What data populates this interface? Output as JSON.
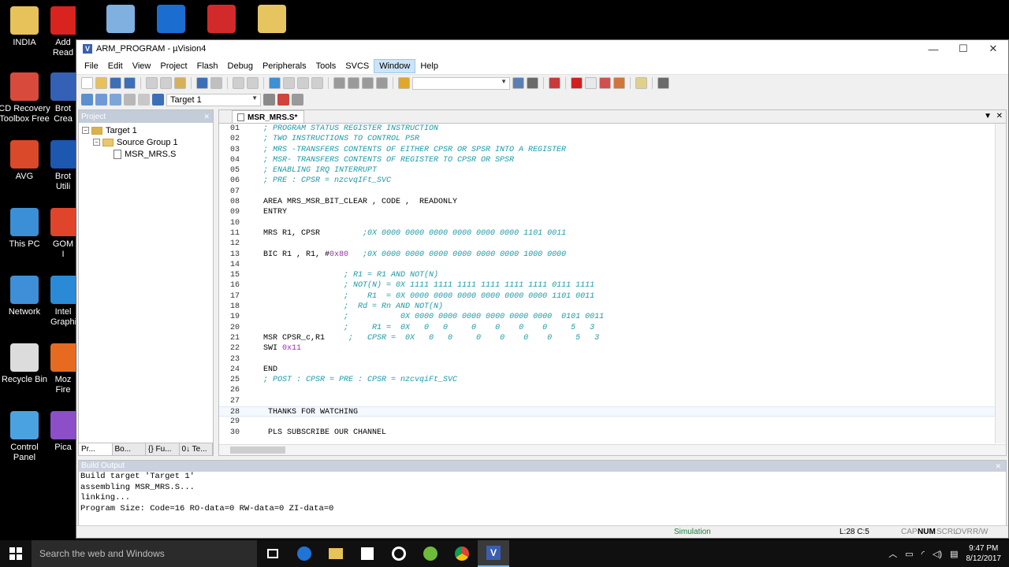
{
  "desktop": {
    "icons_col1": [
      {
        "label": "INDIA",
        "color": "#e7c25a"
      },
      {
        "label": "CD Recovery Toolbox Free",
        "color": "#d84b3c"
      },
      {
        "label": "AVG",
        "color": "#d9492a"
      },
      {
        "label": "This PC",
        "color": "#3b8fd6"
      },
      {
        "label": "Network",
        "color": "#3e8fd8"
      },
      {
        "label": "Recycle Bin",
        "color": "#dcdcdc"
      },
      {
        "label": "Control Panel",
        "color": "#4aa3e0"
      }
    ],
    "icons_col2": [
      {
        "label": "Add Read",
        "color": "#d9231f"
      },
      {
        "label": "Brot Crea",
        "color": "#3460b5"
      },
      {
        "label": "Brot Utili",
        "color": "#1c57b0"
      },
      {
        "label": "GOM I",
        "color": "#e0442a"
      },
      {
        "label": "Intel Graphi",
        "color": "#2a8ad6"
      },
      {
        "label": "Moz Fire",
        "color": "#e66a1f"
      },
      {
        "label": "Pica",
        "color": "#8c4fc8"
      }
    ],
    "icons_top": [
      {
        "label": "",
        "color": "#e8c15b"
      },
      {
        "label": "",
        "color": "#d12b2b"
      },
      {
        "label": "",
        "color": "#7fb0e0"
      },
      {
        "label": "",
        "color": "#1c6dd0"
      },
      {
        "label": "",
        "color": "#d22a2a"
      },
      {
        "label": "",
        "color": "#e6c460"
      }
    ]
  },
  "window": {
    "title": "ARM_PROGRAM - µVision4",
    "controls": {
      "minimize": "—",
      "maximize": "☐",
      "close": "✕"
    }
  },
  "menu": [
    "File",
    "Edit",
    "View",
    "Project",
    "Flash",
    "Debug",
    "Peripherals",
    "Tools",
    "SVCS",
    "Window",
    "Help"
  ],
  "menu_active": "Window",
  "toolbar2": {
    "target": "Target 1"
  },
  "project": {
    "header": "Project",
    "tree": {
      "target": "Target 1",
      "group": "Source Group 1",
      "file": "MSR_MRS.S"
    },
    "tabs": [
      "Pr...",
      "Bo...",
      "{} Fu...",
      "0↓ Te..."
    ]
  },
  "editor": {
    "tab_label": "MSR_MRS.S*",
    "current_line": 28,
    "lines": [
      {
        "n": "01",
        "code": "",
        "comment": "; PROGRAM STATUS REGISTER INSTRUCTION"
      },
      {
        "n": "02",
        "code": "",
        "comment": "; TWO INSTRUCTIONS TO CONTROL PSR"
      },
      {
        "n": "03",
        "code": "",
        "comment": "; MRS -TRANSFERS CONTENTS OF EITHER CPSR OR SPSR INTO A REGISTER"
      },
      {
        "n": "04",
        "code": "",
        "comment": "; MSR- TRANSFERS CONTENTS OF REGISTER TO CPSR OR SPSR"
      },
      {
        "n": "05",
        "code": "",
        "comment": "; ENABLING IRQ INTERRUPT"
      },
      {
        "n": "06",
        "code": "",
        "comment": "; PRE : CPSR = nzcvqIFt_SVC"
      },
      {
        "n": "07",
        "code": "",
        "comment": ""
      },
      {
        "n": "08",
        "code": "AREA MRS_MSR_BIT_CLEAR , CODE ,  READONLY",
        "comment": ""
      },
      {
        "n": "09",
        "code": "ENTRY",
        "comment": ""
      },
      {
        "n": "10",
        "code": "",
        "comment": ""
      },
      {
        "n": "11",
        "code": "MRS R1, CPSR         ",
        "comment": ";0X 0000 0000 0000 0000 0000 0000 1101 0011"
      },
      {
        "n": "12",
        "code": "",
        "comment": ""
      },
      {
        "n": "13",
        "code": "BIC R1 , R1, #",
        "num": "0x80",
        "code2": "   ",
        "comment": ";0X 0000 0000 0000 0000 0000 0000 1000 0000"
      },
      {
        "n": "14",
        "code": "",
        "comment": ""
      },
      {
        "n": "15",
        "code": "                 ",
        "comment": "; R1 = R1 AND NOT(N)"
      },
      {
        "n": "16",
        "code": "                 ",
        "comment": "; NOT(N) = 0X 1111 1111 1111 1111 1111 1111 0111 1111"
      },
      {
        "n": "17",
        "code": "                 ",
        "comment": ";    R1  = 0X 0000 0000 0000 0000 0000 0000 1101 0011"
      },
      {
        "n": "18",
        "code": "                 ",
        "comment": ";  Rd = Rn AND NOT(N)"
      },
      {
        "n": "19",
        "code": "                 ",
        "comment": ";           0X 0000 0000 0000 0000 0000 0000  0101 0011"
      },
      {
        "n": "20",
        "code": "                 ",
        "comment": ";     R1 =  0X   0   0     0    0    0    0     5   3"
      },
      {
        "n": "21",
        "code": "MSR CPSR_c,R1     ",
        "comment": ";   CPSR =  0X   0   0     0    0    0    0     5   3"
      },
      {
        "n": "22",
        "code": "SWI ",
        "num": "0x11",
        "code2": "",
        "comment": ""
      },
      {
        "n": "23",
        "code": "",
        "comment": ""
      },
      {
        "n": "24",
        "code": "END",
        "comment": ""
      },
      {
        "n": "25",
        "code": "",
        "comment": "; POST : CPSR = PRE : CPSR = nzcvqiFt_SVC"
      },
      {
        "n": "26",
        "code": "",
        "comment": ""
      },
      {
        "n": "27",
        "code": "",
        "comment": ""
      },
      {
        "n": "28",
        "code": " THANKS FOR WATCHING",
        "comment": ""
      },
      {
        "n": "29",
        "code": "",
        "comment": ""
      },
      {
        "n": "30",
        "code": " PLS SUBSCRIBE OUR CHANNEL",
        "comment": ""
      }
    ]
  },
  "build": {
    "header": "Build Output",
    "lines": [
      "Build target 'Target 1'",
      "assembling MSR_MRS.S...",
      "linking...",
      "Program Size: Code=16 RO-data=0 RW-data=0 ZI-data=0"
    ]
  },
  "status": {
    "mode": "Simulation",
    "position": "L:28 C:5",
    "caps": "CAP",
    "num": "NUM",
    "scrl": "SCRL",
    "ovr": "OVR",
    "rw": "R/W"
  },
  "taskbar": {
    "search_placeholder": "Search the web and Windows",
    "time": "9:47 PM",
    "date": "8/12/2017"
  }
}
